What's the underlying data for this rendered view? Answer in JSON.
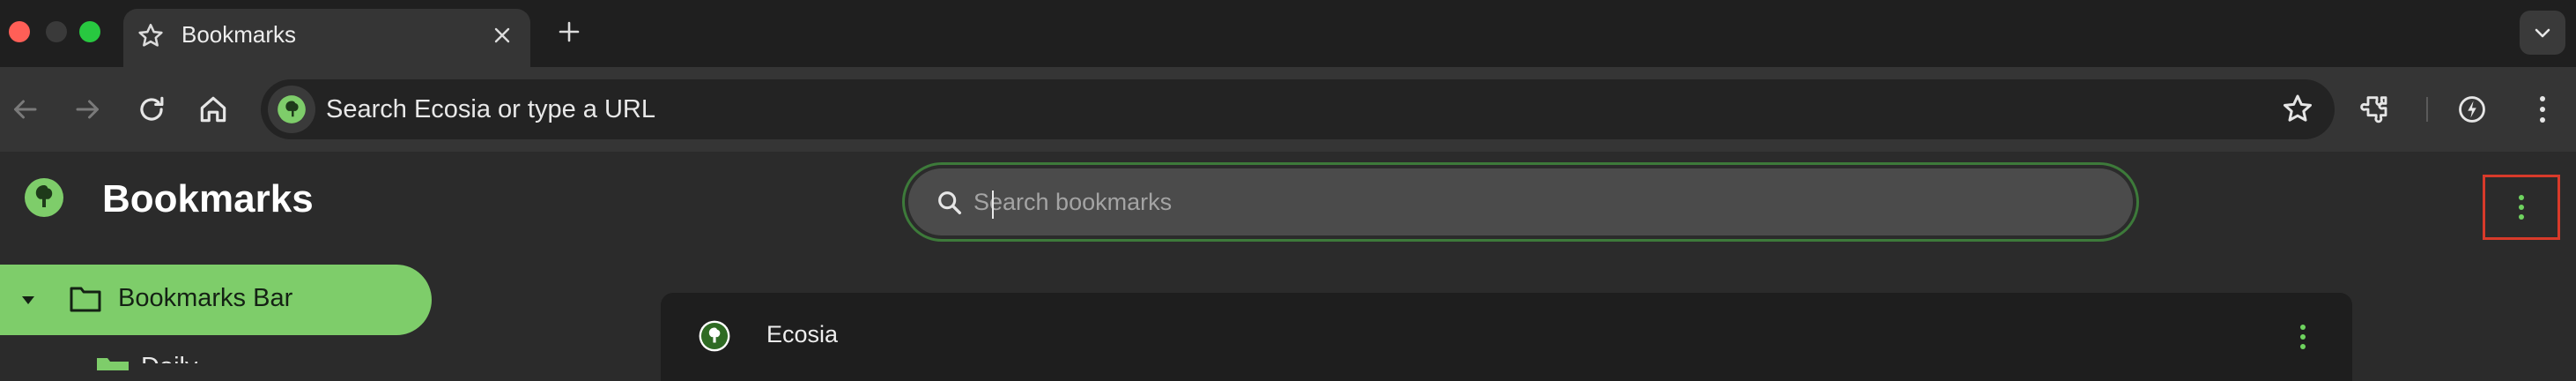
{
  "window": {
    "controls": [
      "close",
      "minimize",
      "zoom"
    ]
  },
  "tab": {
    "title": "Bookmarks",
    "icon": "star-icon"
  },
  "toolbar": {
    "omnibox_placeholder": "Search Ecosia or type a URL"
  },
  "page": {
    "title": "Bookmarks",
    "search": {
      "placeholder": "Search bookmarks",
      "value": ""
    }
  },
  "sidebar": {
    "items": [
      {
        "label": "Bookmarks Bar",
        "expanded": true,
        "selected": true
      }
    ],
    "sub_items": [
      {
        "label": "Daily"
      }
    ]
  },
  "bookmarks": [
    {
      "title": "Ecosia",
      "icon": "ecosia-logo-icon"
    }
  ],
  "colors": {
    "accent_green": "#7ecd6a",
    "highlight_box": "#d83a2a",
    "menu_dot_green": "#6fd35f"
  }
}
